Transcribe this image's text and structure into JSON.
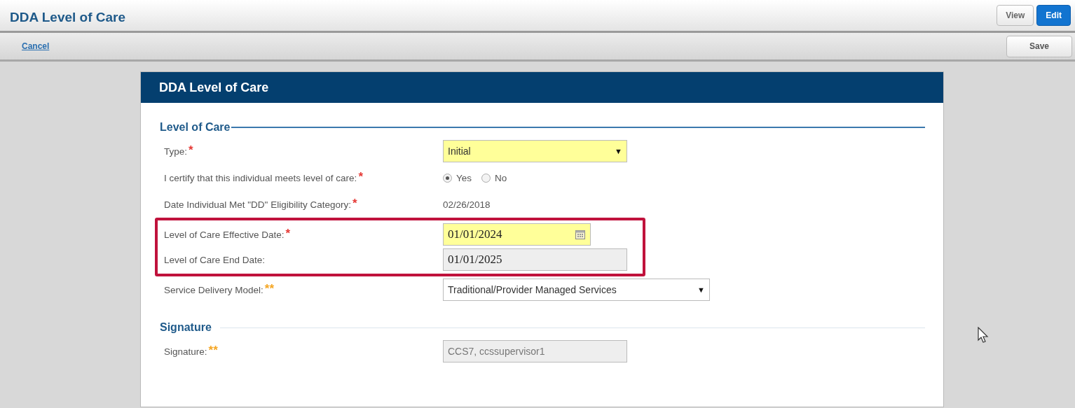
{
  "header": {
    "title": "DDA Level of Care",
    "modes": [
      {
        "label": "View",
        "selected": false
      },
      {
        "label": "Edit",
        "selected": true
      }
    ]
  },
  "toolbar": {
    "cancel": "Cancel",
    "save": "Save"
  },
  "card": {
    "title": "DDA Level of Care",
    "sections": [
      {
        "title": "Level of Care",
        "rows": [
          {
            "label": "Type:",
            "marker": {
              "text": "*",
              "color": "#e53935"
            },
            "kind": "select",
            "value": "Initial",
            "arrow": "▼",
            "required": true,
            "wide": false
          },
          {
            "label": "I certify that this individual meets level of care:",
            "marker": {
              "text": "*",
              "color": "#e53935"
            },
            "kind": "radio",
            "options": [
              {
                "label": "Yes",
                "selected": true
              },
              {
                "label": "No",
                "selected": false
              }
            ]
          },
          {
            "label": "Date Individual Met \"DD\" Eligibility Category:",
            "marker": {
              "text": "*",
              "color": "#e53935"
            },
            "kind": "text",
            "value": "02/26/2018"
          },
          {
            "kind": "highlight-frame",
            "rows": [
              {
                "label": "Level of Care Effective Date:",
                "marker": {
                  "text": "*",
                  "color": "#e53935"
                },
                "kind": "date",
                "value": "01/01/2024",
                "required": true,
                "disabled": false
              },
              {
                "label": "Level of Care End Date:",
                "kind": "date",
                "value": "01/01/2025",
                "required": false,
                "disabled": true
              }
            ]
          },
          {
            "label": "Service Delivery Model:",
            "marker": {
              "text": "**",
              "color": "#f5a623"
            },
            "kind": "select",
            "value": "Traditional/Provider Managed Services",
            "arrow": "▼",
            "required": false,
            "wide": true
          }
        ]
      },
      {
        "title": "Signature",
        "rows": [
          {
            "label": "Signature:",
            "marker": {
              "text": "**",
              "color": "#f5a623"
            },
            "kind": "input",
            "value": "CCS7, ccssupervisor1",
            "disabled": true
          }
        ]
      }
    ]
  }
}
